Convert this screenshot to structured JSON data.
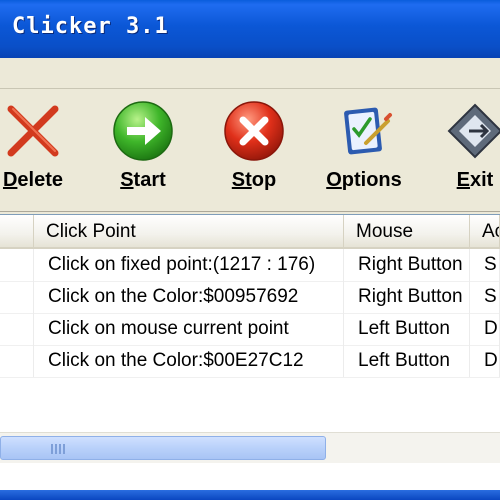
{
  "window": {
    "title": "Clicker 3.1"
  },
  "toolbar": {
    "buttons": [
      {
        "label_u": "D",
        "label_rest": "elete",
        "icon": "delete-x-icon"
      },
      {
        "label_u": "S",
        "label_rest": "tart",
        "icon": "start-arrow-icon"
      },
      {
        "label_u": "St",
        "label_rest": "op",
        "icon": "stop-x-icon"
      },
      {
        "label_u": "O",
        "label_rest": "ptions",
        "icon": "options-checklist-icon"
      },
      {
        "label_u": "E",
        "label_rest": "xit",
        "icon": "exit-icon"
      }
    ]
  },
  "list": {
    "columns": [
      "",
      "Click Point",
      "Mouse",
      "Ac"
    ],
    "rows": [
      {
        "point": "Click on fixed point:(1217 : 176)",
        "mouse": "Right Button",
        "action": "S"
      },
      {
        "point": "Click on the Color:$00957692",
        "mouse": "Right Button",
        "action": "S"
      },
      {
        "point": "Click on mouse current point",
        "mouse": "Left Button",
        "action": "D"
      },
      {
        "point": "Click on the Color:$00E27C12",
        "mouse": "Left Button",
        "action": "D"
      }
    ]
  },
  "colors": {
    "titlebar": "#0a57d6",
    "toolbar_bg": "#ece9d8",
    "scroll_thumb": "#b9d1fa"
  }
}
